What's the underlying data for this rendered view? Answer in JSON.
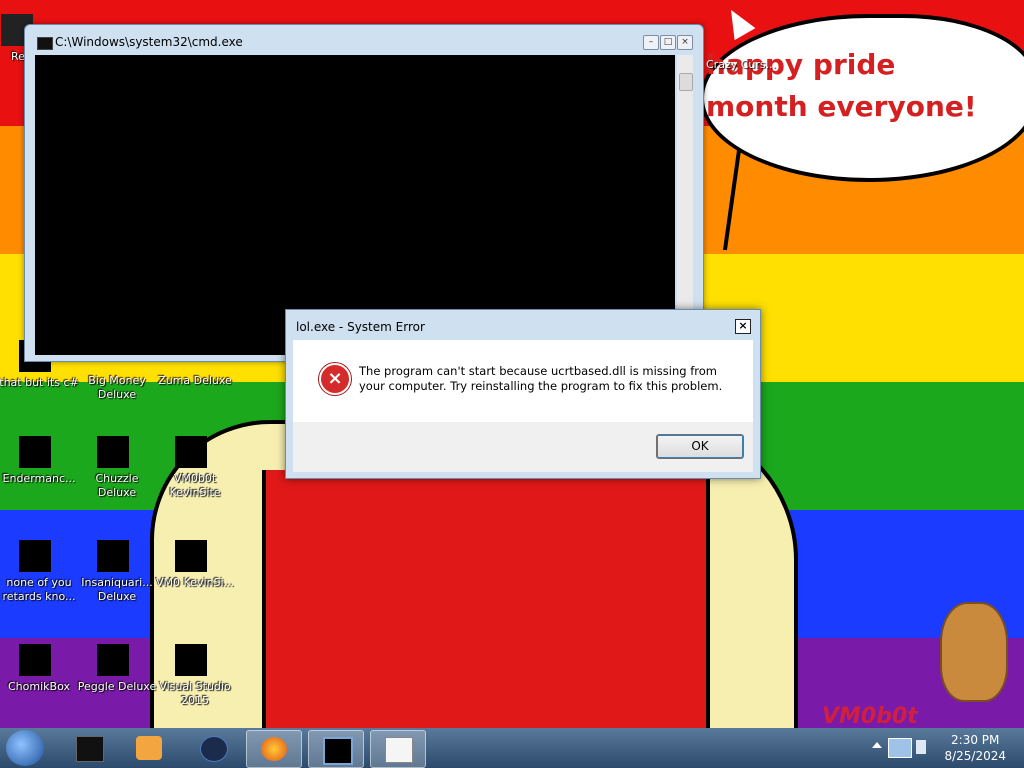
{
  "colors": {
    "rainbow": [
      "#e81010",
      "#ff8c00",
      "#ffe000",
      "#1ca81c",
      "#1b3bff",
      "#7a1aa8"
    ],
    "error_red": "#d42b2b",
    "taskbar_top": "#5a7a9c",
    "taskbar_bottom": "#2b4a6c"
  },
  "wallpaper": {
    "speech_text": "happy pride month everyone!",
    "brand_text": "VM0b0t",
    "cursor_label": "Crazy Curs..."
  },
  "desktop_icons": [
    {
      "label": "Rec",
      "icon": "recycle-bin-icon"
    },
    {
      "label": "that but its c#",
      "icon": "app-icon"
    },
    {
      "label": "Big Money Deluxe",
      "icon": "game-icon"
    },
    {
      "label": "Zuma Deluxe",
      "icon": "game-icon"
    },
    {
      "label": "Endermanc...",
      "icon": "terminal-icon"
    },
    {
      "label": "Chuzzle Deluxe",
      "icon": "game-icon"
    },
    {
      "label": "VM0b0t KevinSite",
      "icon": "shortcut-icon"
    },
    {
      "label": "none of you retards kno...",
      "icon": "firefox-icon"
    },
    {
      "label": "Insaniquari... Deluxe",
      "icon": "game-icon"
    },
    {
      "label": "VM0 KevinSi...",
      "icon": "shortcut-icon"
    },
    {
      "label": "ChomikBox",
      "icon": "app-icon"
    },
    {
      "label": "Peggle Deluxe",
      "icon": "game-icon"
    },
    {
      "label": "Visual Studio 2015",
      "icon": "visual-studio-icon"
    }
  ],
  "cmd_window": {
    "title": "C:\\Windows\\system32\\cmd.exe",
    "minimize": "–",
    "maximize": "□",
    "close": "×"
  },
  "error_dialog": {
    "title": "lol.exe - System Error",
    "close": "×",
    "icon_glyph": "×",
    "message": "The program can't start because ucrtbased.dll is missing from your computer. Try reinstalling the program to fix this problem.",
    "ok_label": "OK"
  },
  "taskbar": {
    "pinned": [
      "cmd-icon",
      "media-player-icon",
      "globe-icon",
      "firefox-icon",
      "console-window-icon",
      "notepad-icon"
    ],
    "time": "2:30 PM",
    "date": "8/25/2024"
  }
}
